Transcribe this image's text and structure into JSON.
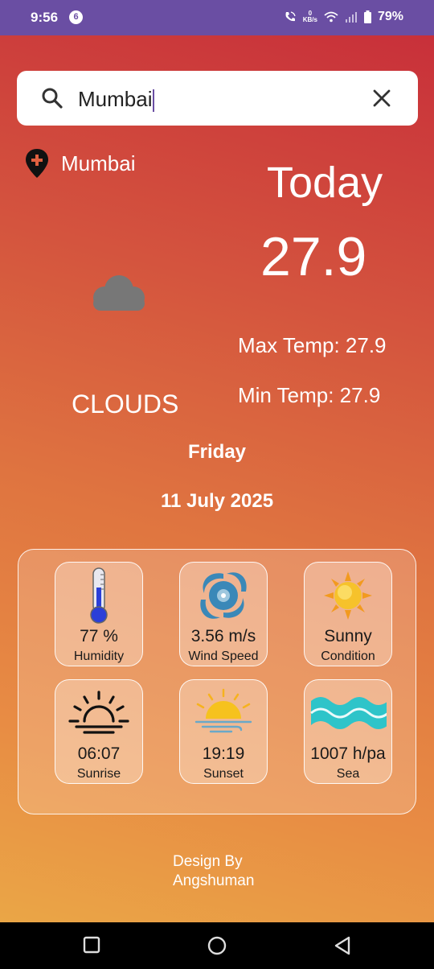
{
  "status_bar": {
    "time": "9:56",
    "notification_count": "6",
    "speed_value": "0",
    "speed_unit": "KB/s",
    "battery": "79%"
  },
  "search": {
    "value": "Mumbai",
    "placeholder": ""
  },
  "location": {
    "city": "Mumbai"
  },
  "weather": {
    "today_label": "Today",
    "temperature": "27.9",
    "max_temp": "Max Temp: 27.9",
    "min_temp": "Min Temp: 27.9",
    "condition": "CLOUDS",
    "day": "Friday",
    "date": "11 July 2025"
  },
  "details": {
    "humidity": {
      "value": "77 %",
      "label": "Humidity",
      "icon": "thermometer-icon"
    },
    "wind": {
      "value": "3.56 m/s",
      "label": "Wind Speed",
      "icon": "cyclone-icon"
    },
    "condition": {
      "value": "Sunny",
      "label": "Condition",
      "icon": "sun-icon"
    },
    "sunrise": {
      "value": "06:07",
      "label": "Sunrise",
      "icon": "sunrise-icon"
    },
    "sunset": {
      "value": "19:19",
      "label": "Sunset",
      "icon": "sunset-icon"
    },
    "sea": {
      "value": "1007 h/pa",
      "label": "Sea",
      "icon": "waves-icon"
    }
  },
  "credit": {
    "line1": "Design By",
    "line2": "Angshuman"
  },
  "colors": {
    "status_bar": "#6a4ea3",
    "gradient_top": "#c8303a",
    "gradient_bottom": "#eaa646"
  }
}
